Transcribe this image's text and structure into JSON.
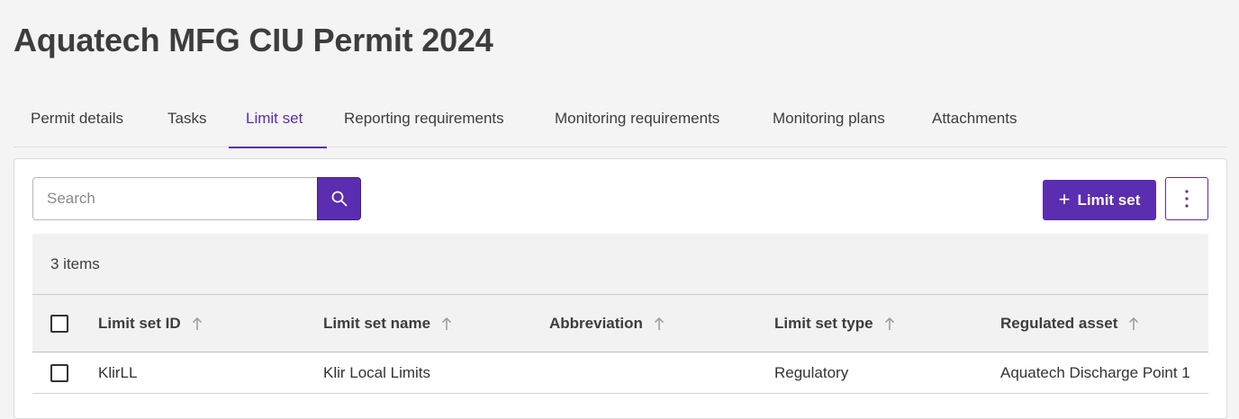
{
  "page": {
    "title": "Aquatech MFG CIU Permit 2024"
  },
  "tabs": [
    {
      "label": "Permit details"
    },
    {
      "label": "Tasks"
    },
    {
      "label": "Limit set",
      "active": true
    },
    {
      "label": "Reporting requirements"
    },
    {
      "label": "Monitoring requirements"
    },
    {
      "label": "Monitoring plans"
    },
    {
      "label": "Attachments"
    }
  ],
  "toolbar": {
    "search_placeholder": "Search",
    "add_label": "Limit set",
    "search_icon": "search-icon",
    "more_icon": "vertical-ellipsis-icon"
  },
  "table": {
    "item_count": "3 items",
    "columns": [
      {
        "label": "Limit set ID"
      },
      {
        "label": "Limit set name"
      },
      {
        "label": "Abbreviation"
      },
      {
        "label": "Limit set type"
      },
      {
        "label": "Regulated asset"
      }
    ],
    "rows": [
      {
        "id": "KlirLL",
        "name": "Klir Local Limits",
        "abbreviation": "",
        "type": "Regulatory",
        "asset": "Aquatech Discharge Point 1"
      }
    ]
  },
  "colors": {
    "accent": "#5b2db0",
    "background": "#f4f4f4"
  }
}
